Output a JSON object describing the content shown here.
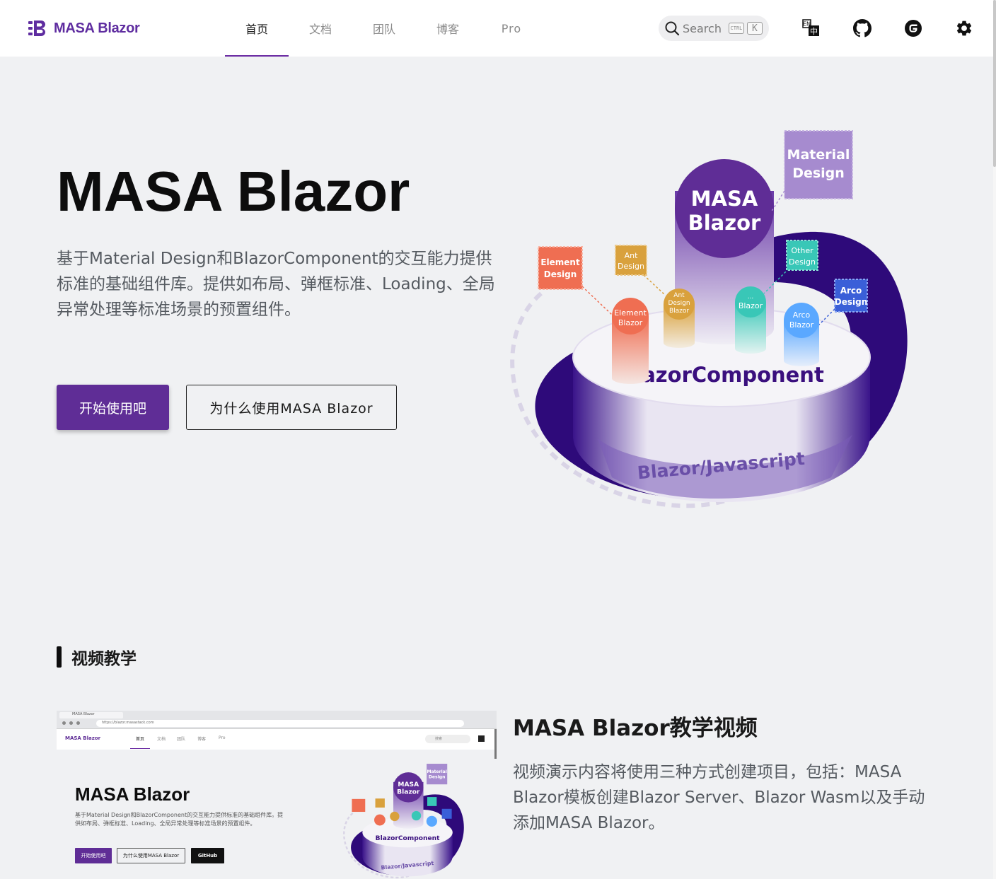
{
  "header": {
    "logo_text": "MASA Blazor",
    "tabs": [
      {
        "label": "首页",
        "active": true
      },
      {
        "label": "文档",
        "active": false
      },
      {
        "label": "团队",
        "active": false
      },
      {
        "label": "博客",
        "active": false
      },
      {
        "label": "Pro",
        "active": false
      }
    ],
    "search": {
      "label": "Search",
      "shortcut_modifier": "CTRL",
      "shortcut_key": "K"
    },
    "icons": [
      "translate-icon",
      "github-icon",
      "gitee-icon",
      "settings-gear-icon"
    ]
  },
  "hero": {
    "title": "MASA Blazor",
    "description": "基于Material Design和BlazorComponent的交互能力提供标准的基础组件库。提供如布局、弹框标准、Loading、全局异常处理等标准场景的预置组件。",
    "primary_button": "开始使用吧",
    "secondary_button": "为什么使用MASA Blazor",
    "illustration": {
      "core": "MASA\nBlazor",
      "material": "Material\nDesign",
      "other": "Other\nDesign",
      "element_design": "Element\nDesign",
      "ant_design": "Ant\nDesign",
      "arco_design": "Arco\nDesign",
      "element_blazor": "Element\nBlazor",
      "ant_blazor": "Ant\nDesign\nBlazor",
      "dots_blazor": "...\nBlazor",
      "arco_blazor": "Arco\nBlazor",
      "platform": "BlazorComponent",
      "base": "Blazor/Javascript"
    }
  },
  "section": {
    "heading": "视频教学"
  },
  "video": {
    "title": "MASA Blazor教学视频",
    "description": "视频演示内容将使用三种方式创建项目，包括：MASA Blazor模板创建Blazor Server、Blazor Wasm以及手动添加MASA Blazor。",
    "thumbnail": {
      "tab_title": "MASA Blazor",
      "url": "https://blazor.masastack.com",
      "logo_text": "MASA Blazor",
      "nav": [
        "首页",
        "文档",
        "团队",
        "博客",
        "Pro"
      ],
      "search_placeholder": "搜索",
      "title": "MASA Blazor",
      "description": "基于Material Design和BlazorComponent的交互能力提供标准的基础组件库。提供如布局、弹框标准、Loading、全局异常处理等标准场景的预置组件。",
      "buttons": [
        "开始使用吧",
        "为什么使用MASA Blazor",
        "GitHub"
      ]
    }
  },
  "colors": {
    "brand": "#5f2d96",
    "accent_line": "#6a2aa2",
    "background": "#f0f1f3",
    "deep_indigo": "#2e0a7a",
    "material_box": "#a68bcf",
    "element_orange": "#ef6e52",
    "ant_gold": "#d9a13d",
    "teal": "#39c7b7",
    "arco_blue": "#3a5fd8"
  }
}
